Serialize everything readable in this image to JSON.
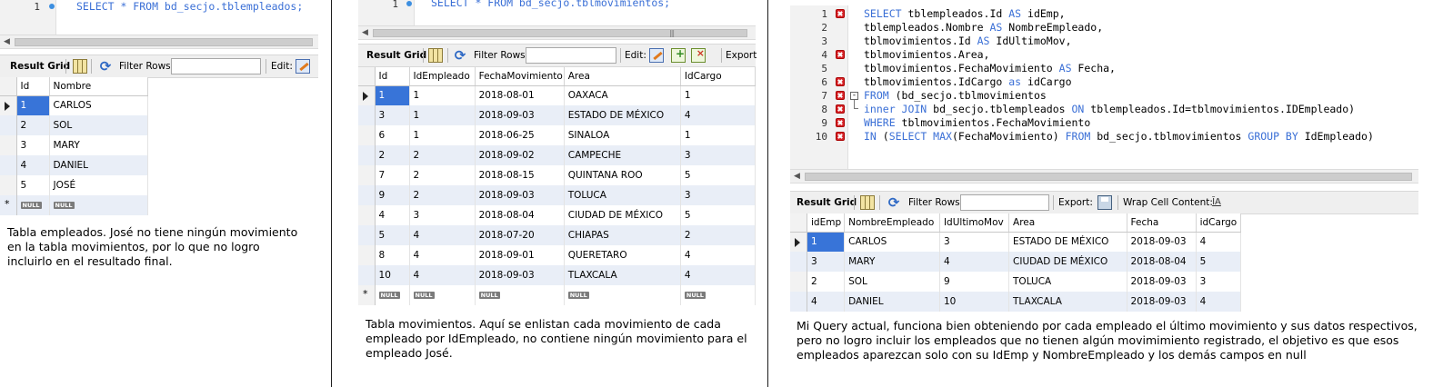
{
  "panel1": {
    "editor": {
      "line_number": "1",
      "code": "SELECT * FROM bd_secjo.tblempleados;"
    },
    "toolbar": {
      "result_grid": "Result Grid",
      "filter_rows": "Filter Rows:",
      "edit": "Edit:"
    },
    "table": {
      "columns": [
        "Id",
        "Nombre"
      ],
      "rows": [
        [
          "1",
          "CARLOS"
        ],
        [
          "2",
          "SOL"
        ],
        [
          "3",
          "MARY"
        ],
        [
          "4",
          "DANIEL"
        ],
        [
          "5",
          "JOSÉ"
        ]
      ],
      "null_label": "NULL"
    },
    "caption": [
      "Tabla empleados. José no tiene ningún movimiento",
      "en la tabla movimientos, por lo que no logro",
      "incluirlo en el resultado final."
    ]
  },
  "panel2": {
    "editor": {
      "line_number": "1",
      "code": "SELECT * FROM bd_secjo.tblmovimientos;"
    },
    "toolbar": {
      "result_grid": "Result Grid",
      "filter_rows": "Filter Rows:",
      "edit": "Edit:",
      "export": "Export"
    },
    "table": {
      "columns": [
        "Id",
        "IdEmpleado",
        "FechaMovimiento",
        "Area",
        "IdCargo"
      ],
      "rows": [
        [
          "1",
          "1",
          "2018-08-01",
          "OAXACA",
          "1"
        ],
        [
          "3",
          "1",
          "2018-09-03",
          "ESTADO DE MÉXICO",
          "4"
        ],
        [
          "6",
          "1",
          "2018-06-25",
          "SINALOA",
          "1"
        ],
        [
          "2",
          "2",
          "2018-09-02",
          "CAMPECHE",
          "3"
        ],
        [
          "7",
          "2",
          "2018-08-15",
          "QUINTANA ROO",
          "5"
        ],
        [
          "9",
          "2",
          "2018-09-03",
          "TOLUCA",
          "3"
        ],
        [
          "4",
          "3",
          "2018-08-04",
          "CIUDAD DE MÉXICO",
          "5"
        ],
        [
          "5",
          "4",
          "2018-07-20",
          "CHIAPAS",
          "2"
        ],
        [
          "8",
          "4",
          "2018-09-01",
          "QUERETARO",
          "4"
        ],
        [
          "10",
          "4",
          "2018-09-03",
          "TLAXCALA",
          "4"
        ]
      ],
      "null_label": "NULL"
    },
    "caption": [
      "Tabla movimientos. Aquí se enlistan cada movimiento de cada",
      "empleado por IdEmpleado, no contiene ningún movimiento para el",
      "empleado José."
    ]
  },
  "panel3": {
    "editor": {
      "lines": [
        {
          "n": "1",
          "parts": [
            [
              "k",
              "SELECT "
            ],
            [
              "t",
              "tblempleados.Id "
            ],
            [
              "k",
              "AS "
            ],
            [
              "t",
              "idEmp,"
            ]
          ]
        },
        {
          "n": "2",
          "parts": [
            [
              "t",
              "tblempleados.Nombre "
            ],
            [
              "k",
              "AS "
            ],
            [
              "t",
              "NombreEmpleado,"
            ]
          ]
        },
        {
          "n": "3",
          "parts": [
            [
              "t",
              "tblmovimientos.Id "
            ],
            [
              "k",
              "AS "
            ],
            [
              "t",
              "IdUltimoMov,"
            ]
          ]
        },
        {
          "n": "4",
          "parts": [
            [
              "t",
              "tblmovimientos.Area,"
            ]
          ]
        },
        {
          "n": "5",
          "parts": [
            [
              "t",
              "tblmovimientos.FechaMovimiento "
            ],
            [
              "k",
              "AS "
            ],
            [
              "t",
              "Fecha,"
            ]
          ]
        },
        {
          "n": "6",
          "parts": [
            [
              "t",
              "tblmovimientos.IdCargo "
            ],
            [
              "k",
              "as "
            ],
            [
              "t",
              "idCargo"
            ]
          ]
        },
        {
          "n": "7",
          "parts": [
            [
              "k",
              "FROM "
            ],
            [
              "t",
              "(bd_secjo.tblmovimientos"
            ]
          ]
        },
        {
          "n": "8",
          "parts": [
            [
              "k",
              "inner JOIN "
            ],
            [
              "t",
              "bd_secjo.tblempleados "
            ],
            [
              "k",
              "ON "
            ],
            [
              "t",
              "tblempleados.Id=tblmovimientos.IDEmpleado)"
            ]
          ]
        },
        {
          "n": "9",
          "parts": [
            [
              "k",
              "WHERE "
            ],
            [
              "t",
              "tblmovimientos.FechaMovimiento"
            ]
          ]
        },
        {
          "n": "10",
          "parts": [
            [
              "k",
              "IN "
            ],
            [
              "t",
              "("
            ],
            [
              "k",
              "SELECT MAX"
            ],
            [
              "t",
              "(FechaMovimiento) "
            ],
            [
              "k",
              "FROM "
            ],
            [
              "t",
              "bd_secjo.tblmovimientos "
            ],
            [
              "k",
              "GROUP BY "
            ],
            [
              "t",
              "IdEmpleado)"
            ]
          ]
        }
      ]
    },
    "toolbar": {
      "result_grid": "Result Grid",
      "filter_rows": "Filter Rows:",
      "export": "Export:",
      "wrap": "Wrap Cell Content:",
      "wrap_icon": "ĪA"
    },
    "table": {
      "columns": [
        "idEmp",
        "NombreEmpleado",
        "IdUltimoMov",
        "Area",
        "Fecha",
        "idCargo"
      ],
      "rows": [
        [
          "1",
          "CARLOS",
          "3",
          "ESTADO DE MÉXICO",
          "2018-09-03",
          "4"
        ],
        [
          "3",
          "MARY",
          "4",
          "CIUDAD DE MÉXICO",
          "2018-08-04",
          "5"
        ],
        [
          "2",
          "SOL",
          "9",
          "TOLUCA",
          "2018-09-03",
          "3"
        ],
        [
          "4",
          "DANIEL",
          "10",
          "TLAXCALA",
          "2018-09-03",
          "4"
        ]
      ]
    },
    "caption": [
      "Mi Query actual, funciona bien obteniendo por cada empleado el último movimiento y sus datos respectivos,",
      "pero no logro incluir los empleados que no tienen algún movimimiento registrado, el objetivo es que esos",
      "empleados aparezcan solo con su IdEmp y NombreEmpleado y los demás  campos en null"
    ]
  },
  "colors": {
    "selection": "#3874d8",
    "keyword": "#3a6fd6",
    "alt_row": "#e9eef7",
    "error_marker": "#d9262b"
  },
  "icons": [
    "grid-icon",
    "refresh-filter-icon",
    "edit-icon",
    "add-row-icon",
    "delete-row-icon",
    "export-icon",
    "wrap-cell-icon",
    "error-marker-icon",
    "fold-icon",
    "row-pointer-icon"
  ]
}
